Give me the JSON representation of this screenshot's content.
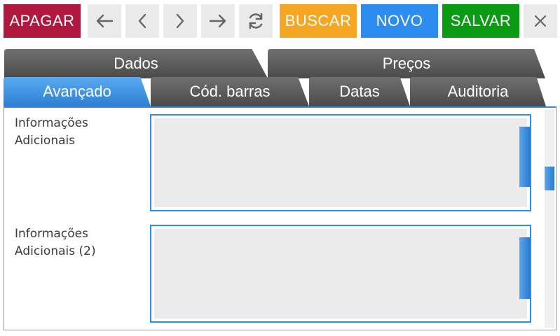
{
  "toolbar": {
    "delete_label": "APAGAR",
    "search_label": "BUSCAR",
    "new_label": "NOVO",
    "save_label": "SALVAR",
    "icons": [
      "arrow-left-icon",
      "chevron-left-icon",
      "chevron-right-icon",
      "arrow-right-icon",
      "sync-icon",
      "close-icon"
    ],
    "colors": {
      "delete": "#b0183f",
      "search": "#f5a623",
      "new": "#2d8cf0",
      "save": "#0b9a13",
      "gray": "#ebebeb"
    }
  },
  "tabs": {
    "row1": [
      "Dados",
      "Preços"
    ],
    "row2": [
      "Avançado",
      "Cód. barras",
      "Datas",
      "Auditoria"
    ],
    "active": "Avançado",
    "active_color": "#2d8cf0"
  },
  "fields": [
    {
      "label_line1": "Informações",
      "label_line2": "Adicionais",
      "value": ""
    },
    {
      "label_line1": "Informações",
      "label_line2": "Adicionais (2)",
      "value": ""
    }
  ]
}
